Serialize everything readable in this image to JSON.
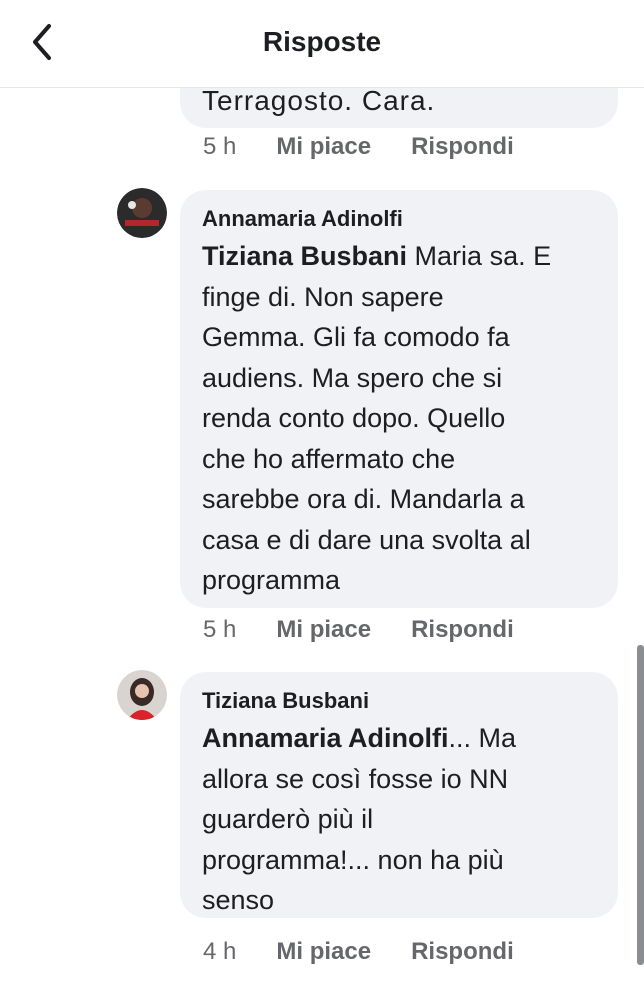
{
  "header": {
    "title": "Risposte",
    "back_icon": "chevron-left-icon"
  },
  "top_comment": {
    "text_fragment": "Terragosto.  Cara.",
    "time": "5 h",
    "like_label": "Mi piace",
    "reply_label": "Rispondi"
  },
  "comments": [
    {
      "author": "Annamaria Adinolfi",
      "mention": "Tiziana Busbani",
      "lines": [
        " Maria sa. E",
        "finge di. Non sapere",
        "Gemma. Gli fa comodo fa",
        "audiens. Ma spero che si",
        "renda conto dopo. Quello",
        "che ho affermato che",
        "sarebbe ora di. Mandarla a",
        "casa e di dare una svolta al",
        "programma"
      ],
      "time": "5 h",
      "like_label": "Mi piace",
      "reply_label": "Rispondi"
    },
    {
      "author": "Tiziana Busbani",
      "mention": "Annamaria Adinolfi",
      "lines": [
        "... Ma",
        "allora se così fosse io NN",
        "guarderò più il",
        "programma!...  non ha più",
        "senso"
      ],
      "time": "4 h",
      "like_label": "Mi piace",
      "reply_label": "Rispondi"
    }
  ],
  "colors": {
    "bubble": "#f0f2f5",
    "meta": "#65676b",
    "text": "#1c1e21"
  }
}
